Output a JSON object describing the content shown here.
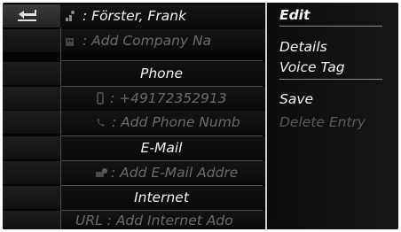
{
  "contact": {
    "name_row": ": Förster, Frank",
    "company_row": ": Add Company Na",
    "phone_header": "Phone",
    "phone_number_row": ": +49172352913",
    "add_phone_row": ": Add Phone Numb",
    "email_header": "E-Mail",
    "add_email_row": ": Add E-Mail Addre",
    "internet_header": "Internet",
    "url_row": "URL : Add Internet Ado"
  },
  "menu": {
    "items": [
      {
        "label": "Edit",
        "state": "selected"
      },
      {
        "label": "Details",
        "state": "normal"
      },
      {
        "label": "Voice Tag",
        "state": "normal"
      },
      {
        "label": "Save",
        "state": "normal"
      },
      {
        "label": "Delete Entry",
        "state": "disabled"
      }
    ]
  },
  "icons": {
    "back": "back-arrow-icon",
    "person": "person-card-icon",
    "company": "company-card-icon",
    "mobile": "mobile-phone-icon",
    "handset": "phone-handset-icon",
    "email": "email-contact-icon"
  },
  "colors": {
    "background": "#050505",
    "text_active": "#f1f1f1",
    "text_dim": "#6a6a6a",
    "menu_divider": "#cfcfcf"
  }
}
